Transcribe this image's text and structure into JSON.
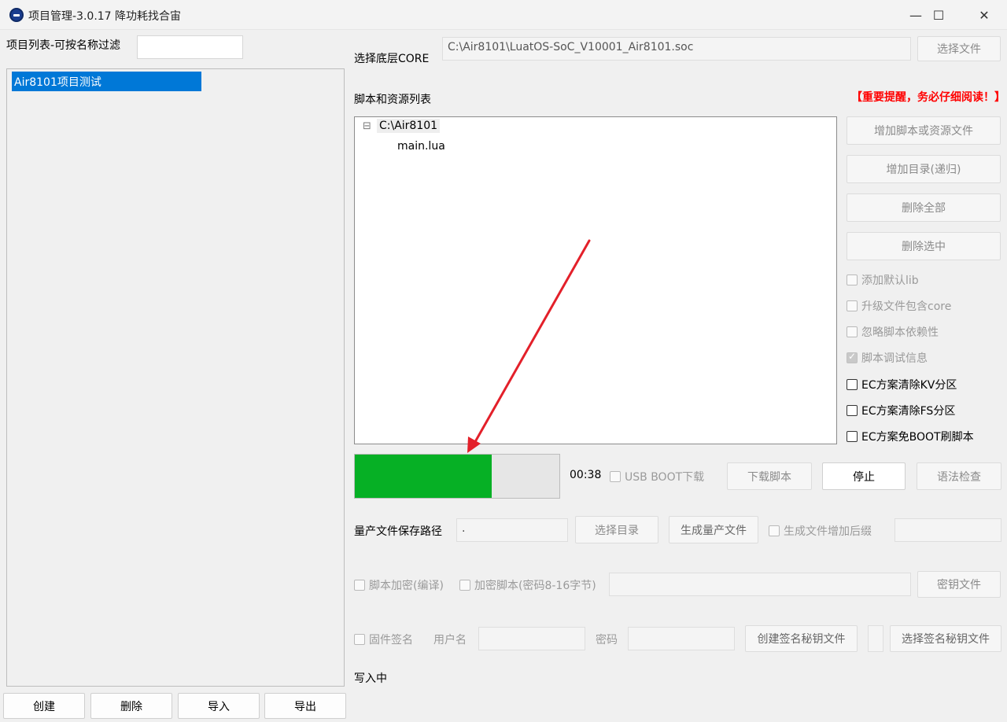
{
  "window": {
    "title": "项目管理-3.0.17 降功耗找合宙",
    "minimize_glyph": "—",
    "maximize_glyph": "☐",
    "close_glyph": "✕"
  },
  "left": {
    "filter_label": "项目列表-可按名称过滤",
    "filter_value": "",
    "projects": [
      "Air8101项目测试"
    ],
    "buttons": {
      "create": "创建",
      "delete": "删除",
      "import": "导入",
      "export": "导出"
    }
  },
  "core": {
    "label": "选择底层CORE",
    "path": "C:\\Air8101\\LuatOS-SoC_V10001_Air8101.soc",
    "choose_file": "选择文件"
  },
  "scripts": {
    "label": "脚本和资源列表",
    "notice": "【重要提醒，务必仔细阅读！】",
    "tree": {
      "collapse_glyph": "⊟",
      "root": "C:\\Air8101",
      "children": [
        "main.lua"
      ]
    }
  },
  "side_buttons": {
    "add_file": "增加脚本或资源文件",
    "add_dir": "增加目录(递归)",
    "delete_all": "删除全部",
    "delete_selected": "删除选中"
  },
  "options": [
    {
      "label": "添加默认lib",
      "state": "disabled-unchecked"
    },
    {
      "label": "升级文件包含core",
      "state": "disabled-unchecked"
    },
    {
      "label": "忽略脚本依赖性",
      "state": "disabled-unchecked"
    },
    {
      "label": "脚本调试信息",
      "state": "disabled-checked"
    },
    {
      "label": "EC方案清除KV分区",
      "state": "enabled-unchecked"
    },
    {
      "label": "EC方案清除FS分区",
      "state": "enabled-unchecked"
    },
    {
      "label": "EC方案免BOOT刷脚本",
      "state": "enabled-unchecked"
    }
  ],
  "progress": {
    "fraction": 0.67,
    "fill_color": "#06b025",
    "elapsed": "00:38",
    "usb_boot": "USB BOOT下载",
    "download": "下载脚本",
    "stop": "停止",
    "syntax": "语法检查"
  },
  "mass": {
    "label": "量产文件保存路径",
    "path": ".",
    "choose_dir": "选择目录",
    "generate": "生成量产文件",
    "suffix": "生成文件增加后缀",
    "suffix_value": ""
  },
  "encrypt": {
    "compile": "脚本加密(编译)",
    "encrypt_script": "加密脚本(密码8-16字节)",
    "password_value": "",
    "key_file": "密钥文件"
  },
  "sign": {
    "firmware_sign": "固件签名",
    "username_label": "用户名",
    "username_value": "",
    "password_label": "密码",
    "password_value": "",
    "create_key": "创建签名秘钥文件",
    "select_key": "选择签名秘钥文件"
  },
  "status": "写入中"
}
